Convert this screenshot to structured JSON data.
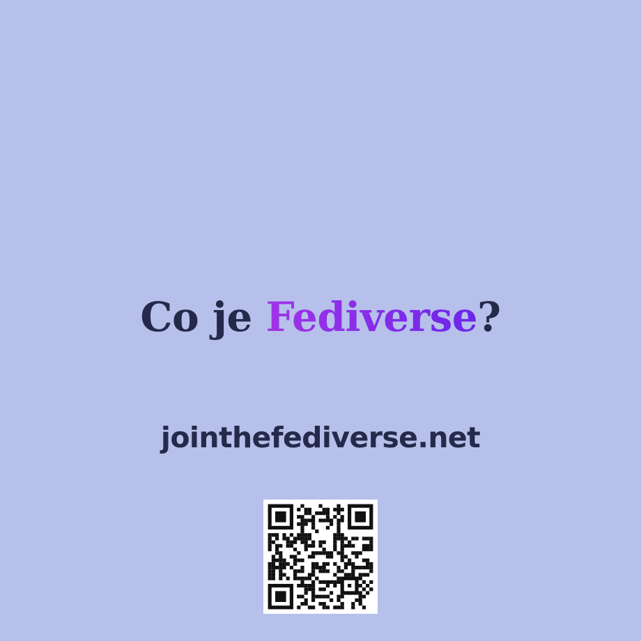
{
  "title": {
    "prefix": "Co je ",
    "highlight": "Fediverse",
    "suffix": "?"
  },
  "url": "jointhefediverse.net",
  "colors": {
    "background": "#b6c0eb",
    "text": "#262a4a",
    "highlight_start": "#a233e6",
    "highlight_end": "#6b26ea"
  },
  "qr": {
    "icon": "qr-code-icon"
  }
}
